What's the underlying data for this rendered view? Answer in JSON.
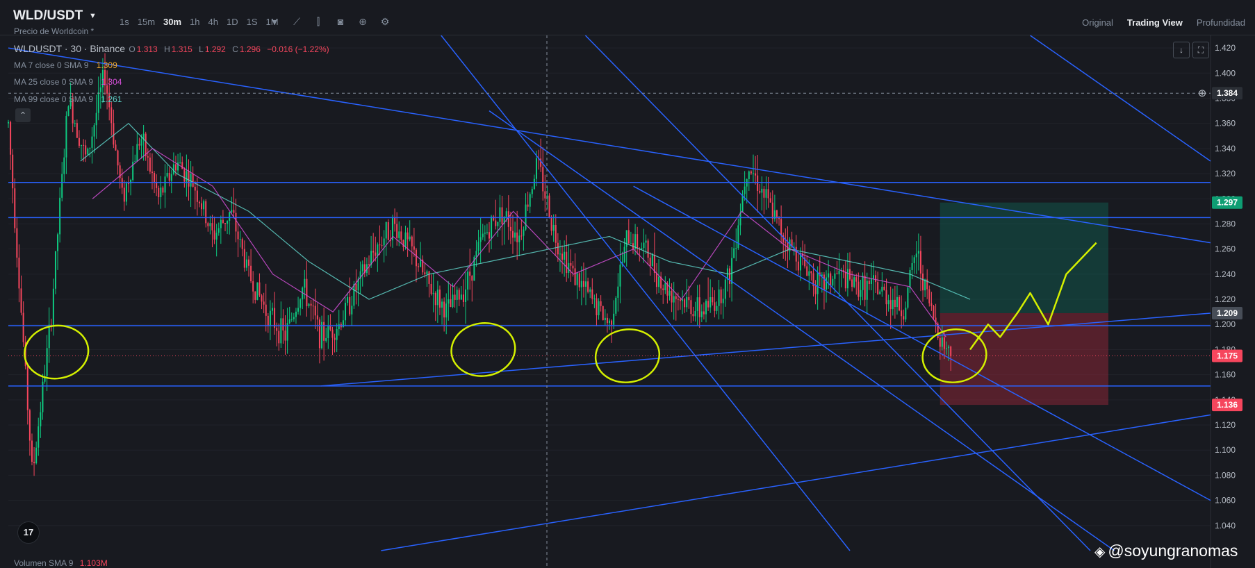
{
  "header": {
    "symbol": "WLD/USDT",
    "subtitle": "Precio de Worldcoin *",
    "timeframes": [
      "1s",
      "15m",
      "30m",
      "1h",
      "4h",
      "1D",
      "1S",
      "1M"
    ],
    "active_timeframe": "30m",
    "views": [
      "Original",
      "Trading View",
      "Profundidad"
    ],
    "active_view": "Trading View"
  },
  "legend": {
    "ticker_line": "WLDUSDT · 30 · Binance",
    "ohlc": {
      "o_label": "O",
      "o": "1.313",
      "h_label": "H",
      "h": "1.315",
      "l_label": "L",
      "l": "1.292",
      "c_label": "C",
      "c": "1.296",
      "change": "−0.016 (−1.22%)"
    },
    "ma": [
      {
        "label": "MA 7 close 0 SMA 9",
        "value": "1.309",
        "color": "#f0a92e"
      },
      {
        "label": "MA 25 close 0 SMA 9",
        "value": "1.304",
        "color": "#d24fd6"
      },
      {
        "label": "MA 99 close 0 SMA 9",
        "value": "1.261",
        "color": "#5fd3c9"
      }
    ],
    "volume": {
      "label": "Volumen SMA 9",
      "value": "1.103M",
      "color": "#f6465d"
    }
  },
  "watermark": "@soyungranomas",
  "logo": "17",
  "colors": {
    "up": "#0ecb81",
    "down": "#f6465d",
    "trendline": "#2962ff",
    "annotation": "#d4f000",
    "background": "#181a20"
  },
  "chart_data": {
    "type": "candlestick",
    "ylim": [
      1.02,
      1.43
    ],
    "y_ticks": [
      "1.420",
      "1.400",
      "1.380",
      "1.360",
      "1.340",
      "1.320",
      "1.300",
      "1.280",
      "1.260",
      "1.240",
      "1.220",
      "1.200",
      "1.180",
      "1.160",
      "1.140",
      "1.120",
      "1.100",
      "1.080",
      "1.060",
      "1.040"
    ],
    "price_labels": [
      {
        "value": "1.384",
        "kind": "crosshair"
      },
      {
        "value": "1.297",
        "kind": "take-profit"
      },
      {
        "value": "1.209",
        "kind": "entry"
      },
      {
        "value": "1.175",
        "kind": "last-price"
      },
      {
        "value": "1.136",
        "kind": "stop-loss"
      }
    ],
    "close_path": [
      [
        0,
        1.36
      ],
      [
        0.02,
        1.08
      ],
      [
        0.035,
        1.2
      ],
      [
        0.05,
        1.38
      ],
      [
        0.065,
        1.33
      ],
      [
        0.08,
        1.4
      ],
      [
        0.095,
        1.3
      ],
      [
        0.11,
        1.35
      ],
      [
        0.125,
        1.3
      ],
      [
        0.14,
        1.33
      ],
      [
        0.155,
        1.31
      ],
      [
        0.17,
        1.27
      ],
      [
        0.185,
        1.29
      ],
      [
        0.2,
        1.24
      ],
      [
        0.215,
        1.21
      ],
      [
        0.23,
        1.19
      ],
      [
        0.245,
        1.23
      ],
      [
        0.26,
        1.19
      ],
      [
        0.275,
        1.2
      ],
      [
        0.29,
        1.23
      ],
      [
        0.305,
        1.26
      ],
      [
        0.32,
        1.28
      ],
      [
        0.335,
        1.26
      ],
      [
        0.35,
        1.23
      ],
      [
        0.365,
        1.21
      ],
      [
        0.38,
        1.23
      ],
      [
        0.395,
        1.27
      ],
      [
        0.41,
        1.29
      ],
      [
        0.425,
        1.27
      ],
      [
        0.44,
        1.33
      ],
      [
        0.455,
        1.27
      ],
      [
        0.47,
        1.24
      ],
      [
        0.485,
        1.22
      ],
      [
        0.5,
        1.2
      ],
      [
        0.515,
        1.27
      ],
      [
        0.53,
        1.26
      ],
      [
        0.545,
        1.23
      ],
      [
        0.56,
        1.22
      ],
      [
        0.575,
        1.21
      ],
      [
        0.59,
        1.22
      ],
      [
        0.6,
        1.24
      ],
      [
        0.615,
        1.33
      ],
      [
        0.63,
        1.3
      ],
      [
        0.645,
        1.27
      ],
      [
        0.66,
        1.25
      ],
      [
        0.675,
        1.23
      ],
      [
        0.69,
        1.24
      ],
      [
        0.705,
        1.23
      ],
      [
        0.72,
        1.23
      ],
      [
        0.735,
        1.22
      ],
      [
        0.745,
        1.21
      ],
      [
        0.755,
        1.26
      ],
      [
        0.765,
        1.22
      ],
      [
        0.775,
        1.19
      ],
      [
        0.785,
        1.175
      ]
    ],
    "ma_paths": [
      {
        "name": "MA 99",
        "points": [
          [
            0.06,
            1.33
          ],
          [
            0.1,
            1.36
          ],
          [
            0.14,
            1.32
          ],
          [
            0.2,
            1.29
          ],
          [
            0.25,
            1.25
          ],
          [
            0.3,
            1.22
          ],
          [
            0.35,
            1.24
          ],
          [
            0.4,
            1.25
          ],
          [
            0.45,
            1.26
          ],
          [
            0.5,
            1.27
          ],
          [
            0.55,
            1.25
          ],
          [
            0.6,
            1.24
          ],
          [
            0.65,
            1.26
          ],
          [
            0.7,
            1.25
          ],
          [
            0.75,
            1.24
          ],
          [
            0.8,
            1.22
          ]
        ]
      },
      {
        "name": "MA 25",
        "points": [
          [
            0.07,
            1.3
          ],
          [
            0.12,
            1.34
          ],
          [
            0.17,
            1.31
          ],
          [
            0.22,
            1.24
          ],
          [
            0.27,
            1.21
          ],
          [
            0.32,
            1.27
          ],
          [
            0.37,
            1.23
          ],
          [
            0.42,
            1.29
          ],
          [
            0.47,
            1.24
          ],
          [
            0.52,
            1.26
          ],
          [
            0.56,
            1.22
          ],
          [
            0.61,
            1.29
          ],
          [
            0.65,
            1.26
          ],
          [
            0.7,
            1.24
          ],
          [
            0.75,
            1.23
          ],
          [
            0.78,
            1.19
          ]
        ]
      }
    ],
    "position": {
      "entry": 1.209,
      "take_profit": 1.297,
      "stop_loss": 1.136,
      "x_start": 0.775,
      "x_end": 0.915
    },
    "horizontal_lines": [
      1.313,
      1.285,
      1.199,
      1.151
    ],
    "trend_lines": [
      {
        "from": [
          0.0,
          1.42
        ],
        "to": [
          1.0,
          1.265
        ]
      },
      {
        "from": [
          0.36,
          1.43
        ],
        "to": [
          0.7,
          1.02
        ]
      },
      {
        "from": [
          0.48,
          1.43
        ],
        "to": [
          0.9,
          1.02
        ]
      },
      {
        "from": [
          0.52,
          1.31
        ],
        "to": [
          1.0,
          1.06
        ]
      },
      {
        "from": [
          0.4,
          1.37
        ],
        "to": [
          0.92,
          1.02
        ]
      },
      {
        "from": [
          0.26,
          1.151
        ],
        "to": [
          1.0,
          1.209
        ]
      },
      {
        "from": [
          0.31,
          1.02
        ],
        "to": [
          1.0,
          1.128
        ]
      },
      {
        "from": [
          0.85,
          1.43
        ],
        "to": [
          1.0,
          1.33
        ]
      }
    ],
    "annotation_circles": [
      {
        "x": 0.04,
        "y": 1.178
      },
      {
        "x": 0.395,
        "y": 1.18
      },
      {
        "x": 0.515,
        "y": 1.175
      },
      {
        "x": 0.787,
        "y": 1.175
      }
    ],
    "projection_path": [
      [
        0.8,
        1.18
      ],
      [
        0.815,
        1.2
      ],
      [
        0.825,
        1.19
      ],
      [
        0.84,
        1.21
      ],
      [
        0.85,
        1.225
      ],
      [
        0.865,
        1.2
      ],
      [
        0.88,
        1.24
      ],
      [
        0.905,
        1.265
      ]
    ]
  }
}
